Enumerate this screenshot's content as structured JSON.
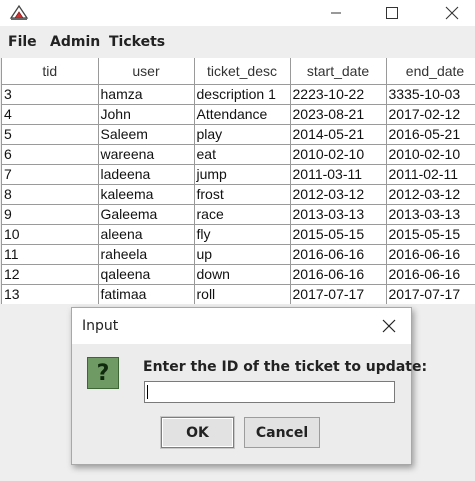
{
  "window": {
    "title": "",
    "controls": [
      "minimize-icon",
      "maximize-icon",
      "close-icon"
    ]
  },
  "menu": {
    "file": "File",
    "admin": "Admin",
    "tickets": "Tickets"
  },
  "table": {
    "columns": [
      "tid",
      "user",
      "ticket_desc",
      "start_date",
      "end_date"
    ],
    "rows": [
      [
        "3",
        "hamza",
        "description 1",
        "2223-10-22",
        "3335-10-03"
      ],
      [
        "4",
        "John",
        "Attendance",
        "2023-08-21",
        "2017-02-12"
      ],
      [
        "5",
        "Saleem",
        "play",
        "2014-05-21",
        "2016-05-21"
      ],
      [
        "6",
        "wareena",
        "eat",
        "2010-02-10",
        "2010-02-10"
      ],
      [
        "7",
        "ladeena",
        "jump",
        "2011-03-11",
        "2011-02-11"
      ],
      [
        "8",
        "kaleema",
        "frost",
        "2012-03-12",
        "2012-03-12"
      ],
      [
        "9",
        "Galeema",
        "race",
        "2013-03-13",
        "2013-03-13"
      ],
      [
        "10",
        "aleena",
        "fly",
        "2015-05-15",
        "2015-05-15"
      ],
      [
        "11",
        "raheela",
        "up",
        "2016-06-16",
        "2016-06-16"
      ],
      [
        "12",
        "qaleena",
        "down",
        "2016-06-16",
        "2016-06-16"
      ],
      [
        "13",
        "fatimaa",
        "roll",
        "2017-07-17",
        "2017-07-17"
      ]
    ]
  },
  "dialog": {
    "title": "Input",
    "icon": "question-icon",
    "icon_glyph": "?",
    "prompt": "Enter the ID of the ticket to update:",
    "input_value": "",
    "ok_label": "OK",
    "cancel_label": "Cancel"
  }
}
